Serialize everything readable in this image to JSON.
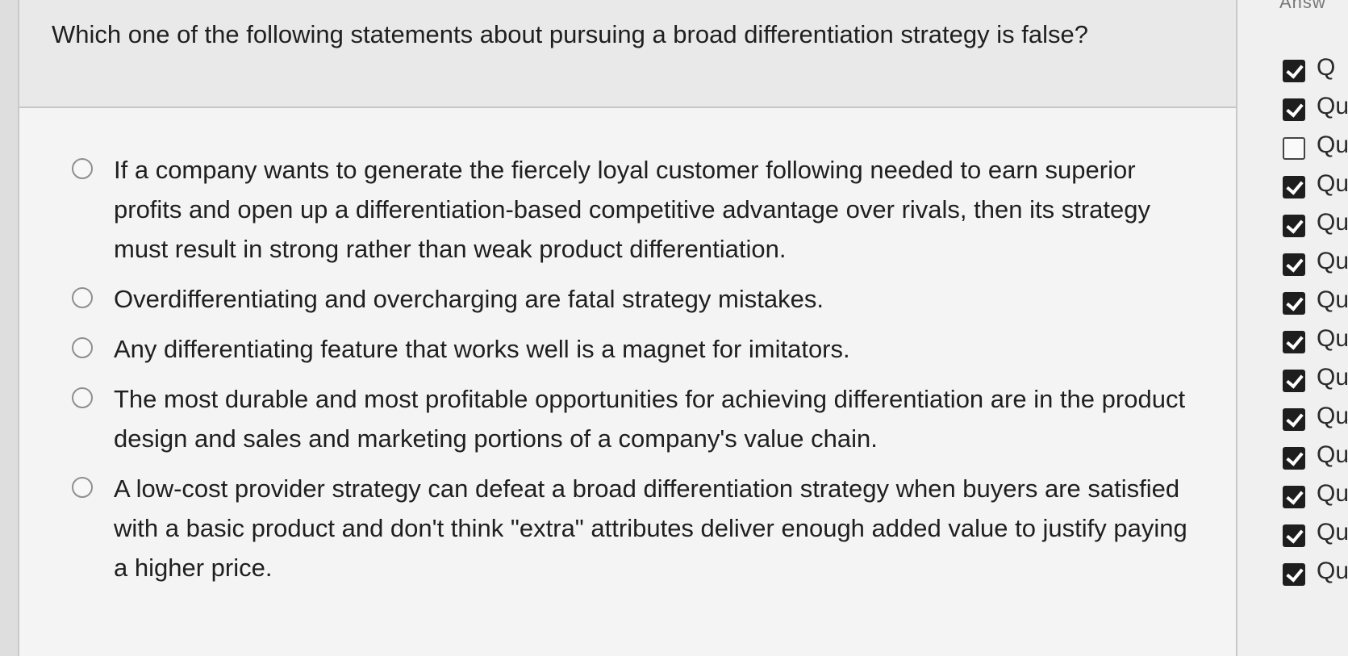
{
  "question": {
    "text": "Which one of the following statements about pursuing a broad differentiation strategy is false?"
  },
  "options": [
    {
      "label": "If a company wants to generate the fiercely loyal customer following needed to earn superior profits and open up a differentiation-based competitive advantage over rivals, then its strategy must result in strong rather than weak product differentiation."
    },
    {
      "label": "Overdifferentiating and overcharging are fatal strategy mistakes."
    },
    {
      "label": "Any differentiating feature that works well is a magnet for imitators."
    },
    {
      "label": "The most durable and most profitable opportunities for achieving differentiation are in the product design and sales and marketing portions of a company's value chain."
    },
    {
      "label": "A low-cost provider strategy can defeat a broad differentiation strategy when buyers are satisfied with a basic product and don't think \"extra\" attributes deliver enough added value to justify paying a higher price."
    }
  ],
  "sidebar": {
    "header": "Answ",
    "items": [
      {
        "label": "Q",
        "checked": true
      },
      {
        "label": "Qu",
        "checked": true
      },
      {
        "label": "Qu",
        "checked": false
      },
      {
        "label": "Qu",
        "checked": true
      },
      {
        "label": "Qu",
        "checked": true
      },
      {
        "label": "Qu",
        "checked": true
      },
      {
        "label": "Qu",
        "checked": true
      },
      {
        "label": "Qu",
        "checked": true
      },
      {
        "label": "Qu",
        "checked": true
      },
      {
        "label": "Qu",
        "checked": true
      },
      {
        "label": "Qu",
        "checked": true
      },
      {
        "label": "Qu",
        "checked": true
      },
      {
        "label": "Qu",
        "checked": true
      },
      {
        "label": "Qu",
        "checked": true
      }
    ]
  }
}
